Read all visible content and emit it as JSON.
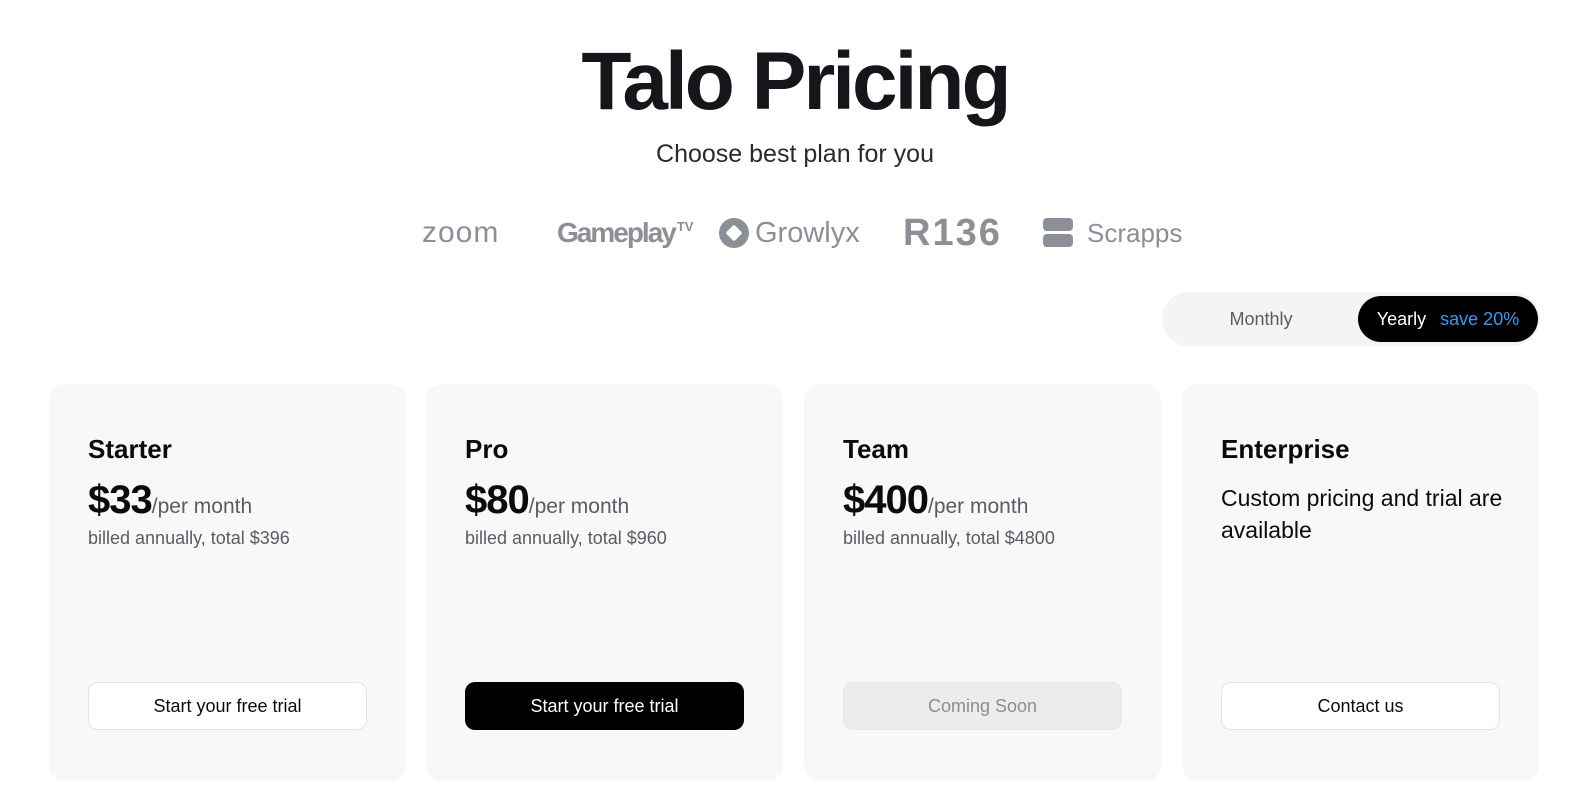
{
  "header": {
    "title": "Talo Pricing",
    "subtitle": "Choose best plan for you"
  },
  "logos": [
    {
      "name": "zoom",
      "text": "zoom"
    },
    {
      "name": "gameplay-tv",
      "text": "Gameplay",
      "suffix": "TV"
    },
    {
      "name": "growlyx",
      "text": "Growlyx"
    },
    {
      "name": "r136",
      "text": "R136"
    },
    {
      "name": "scrapps",
      "text": "Scrapps"
    }
  ],
  "billing_toggle": {
    "monthly_label": "Monthly",
    "yearly_label": "Yearly",
    "yearly_badge": "save 20%",
    "selected": "Yearly"
  },
  "plans": [
    {
      "name": "Starter",
      "price": "$33",
      "period": "/per month",
      "billing": "billed annually, total $396",
      "button": "Start your free trial"
    },
    {
      "name": "Pro",
      "price": "$80",
      "period": "/per month",
      "billing": "billed annually, total $960",
      "button": "Start your free trial"
    },
    {
      "name": "Team",
      "price": "$400",
      "period": "/per month",
      "billing": "billed annually, total $4800",
      "button": "Coming Soon"
    },
    {
      "name": "Enterprise",
      "description": "Custom pricing and trial are available",
      "button": "Contact us"
    }
  ],
  "colors": {
    "accent": "#2e9cf5",
    "primary_button": "#000000",
    "card_background": "#f8f8f8",
    "logo_gray": "#8d8f96"
  }
}
